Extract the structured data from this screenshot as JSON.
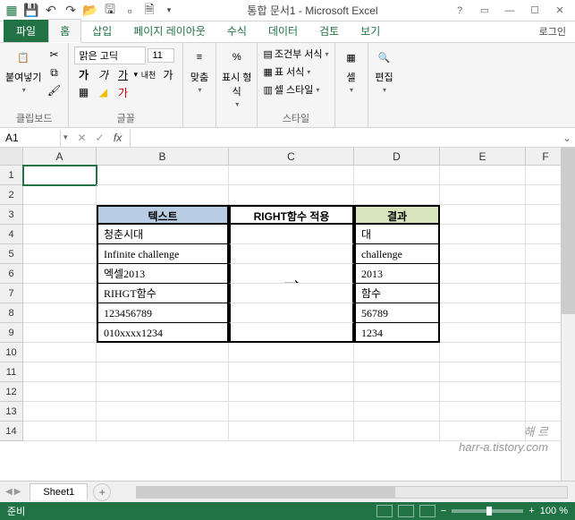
{
  "title": "통합 문서1 - Microsoft Excel",
  "login": "로그인",
  "tabs": {
    "file": "파일",
    "home": "홈",
    "insert": "삽입",
    "layout": "페이지 레이아웃",
    "formula": "수식",
    "data": "데이터",
    "review": "검토",
    "view": "보기"
  },
  "ribbon": {
    "clipboard": {
      "label": "클립보드",
      "paste": "붙여넣기"
    },
    "font": {
      "label": "글꼴",
      "name": "맑은 고딕",
      "size": "11",
      "bold": "가",
      "italic": "가",
      "underline": "가",
      "ruby": "내천",
      "sub": "가"
    },
    "align": {
      "label": "맞춤",
      "btn": "맞춤"
    },
    "number": {
      "label": "표시 형식",
      "btn": "표시 형\n식"
    },
    "style": {
      "label": "스타일",
      "cond": "조건부 서식",
      "table": "표 서식",
      "cell": "셀 스타일"
    },
    "cells": {
      "label": "셀",
      "btn": "셀"
    },
    "edit": {
      "label": "편집",
      "btn": "편집"
    }
  },
  "namebox": "A1",
  "fx": "fx",
  "columns": [
    "A",
    "B",
    "C",
    "D",
    "E",
    "F"
  ],
  "rows": [
    "1",
    "2",
    "3",
    "4",
    "5",
    "6",
    "7",
    "8",
    "9",
    "10",
    "11",
    "12",
    "13",
    "14"
  ],
  "table": {
    "headers": {
      "text": "텍스트",
      "func": "RIGHT함수 적용",
      "result": "결과"
    },
    "data": [
      {
        "text": "청춘시대",
        "result": "대"
      },
      {
        "text": "Infinite challenge",
        "result": "challenge"
      },
      {
        "text": "엑셀2013",
        "result": "2013"
      },
      {
        "text": "RIHGT함수",
        "result": "함수"
      },
      {
        "text": "123456789",
        "result": "56789"
      },
      {
        "text": "010xxxx1234",
        "result": "1234"
      }
    ],
    "arrow": "→"
  },
  "watermark": {
    "line1": "해 르",
    "line2": "harr-a.tistory.com"
  },
  "sheet": {
    "name": "Sheet1",
    "add": "+"
  },
  "status": {
    "ready": "준비",
    "zoom": "100 %"
  }
}
